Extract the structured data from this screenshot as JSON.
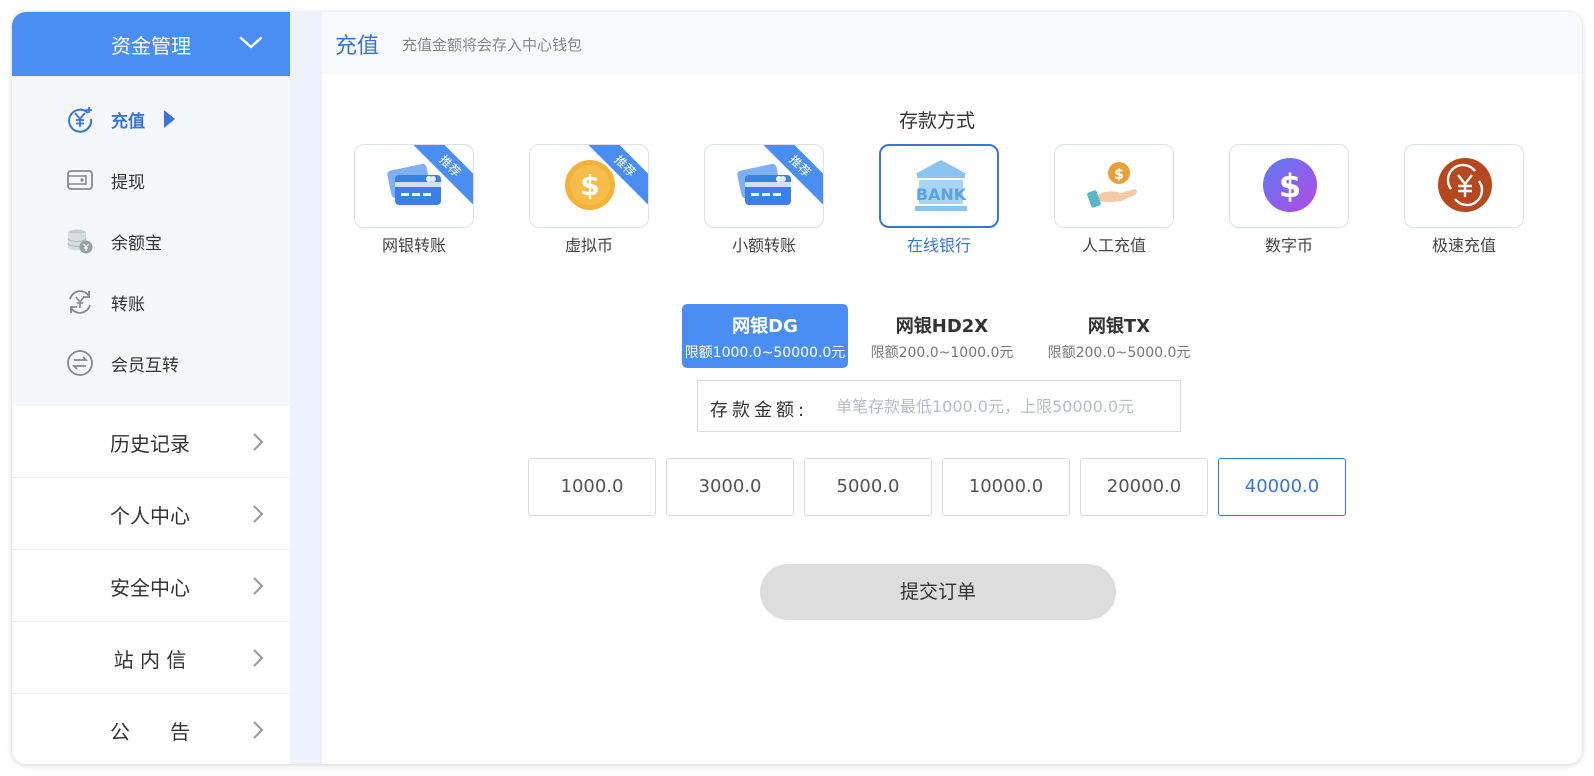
{
  "sidebar": {
    "header": "资金管理",
    "sub_items": [
      {
        "label": "充值",
        "icon": "yen-plus-icon",
        "active": true
      },
      {
        "label": "提现",
        "icon": "wallet-icon",
        "active": false
      },
      {
        "label": "余额宝",
        "icon": "coin-stack-icon",
        "active": false
      },
      {
        "label": "转账",
        "icon": "yen-transfer-icon",
        "active": false
      },
      {
        "label": "会员互转",
        "icon": "exchange-icon",
        "active": false
      }
    ],
    "main_items": [
      {
        "label": "历史记录"
      },
      {
        "label": "个人中心"
      },
      {
        "label": "安全中心"
      },
      {
        "label": "站 内 信"
      },
      {
        "label": "公　　告"
      }
    ]
  },
  "topbar": {
    "title": "充值",
    "description": "充值金额将会存入中心钱包"
  },
  "deposit": {
    "section_title": "存款方式",
    "badge_label": "推荐",
    "methods": [
      {
        "label": "网银转账",
        "icon": "bank-card-icon",
        "badge": true
      },
      {
        "label": "虚拟币",
        "icon": "dollar-coin-icon",
        "badge": true
      },
      {
        "label": "小额转账",
        "icon": "bank-card-icon",
        "badge": true
      },
      {
        "label": "在线银行",
        "icon": "bank-icon",
        "icon_text": "BANK",
        "badge": false,
        "active": true
      },
      {
        "label": "人工充值",
        "icon": "hand-coin-icon",
        "badge": false
      },
      {
        "label": "数字币",
        "icon": "digital-dollar-icon",
        "badge": false
      },
      {
        "label": "极速充值",
        "icon": "fast-yen-icon",
        "badge": false
      }
    ],
    "channels": [
      {
        "name": "网银DG",
        "limit": "限额1000.0~50000.0元",
        "active": true
      },
      {
        "name": "网银HD2X",
        "limit": "限额200.0~1000.0元",
        "active": false
      },
      {
        "name": "网银TX",
        "limit": "限额200.0~5000.0元",
        "active": false
      }
    ],
    "amount_label": "存款金额:",
    "amount_placeholder": "单笔存款最低1000.0元，上限50000.0元",
    "amount_value": "",
    "quick_amounts": [
      "1000.0",
      "3000.0",
      "5000.0",
      "10000.0",
      "20000.0",
      "40000.0"
    ],
    "quick_selected": "40000.0",
    "submit_label": "提交订单"
  },
  "colors": {
    "primary": "#4a8ef3",
    "accent_text": "#3b74d8",
    "sidebar_bg": "#f6f7fb",
    "submit_bg": "#dddddd"
  }
}
